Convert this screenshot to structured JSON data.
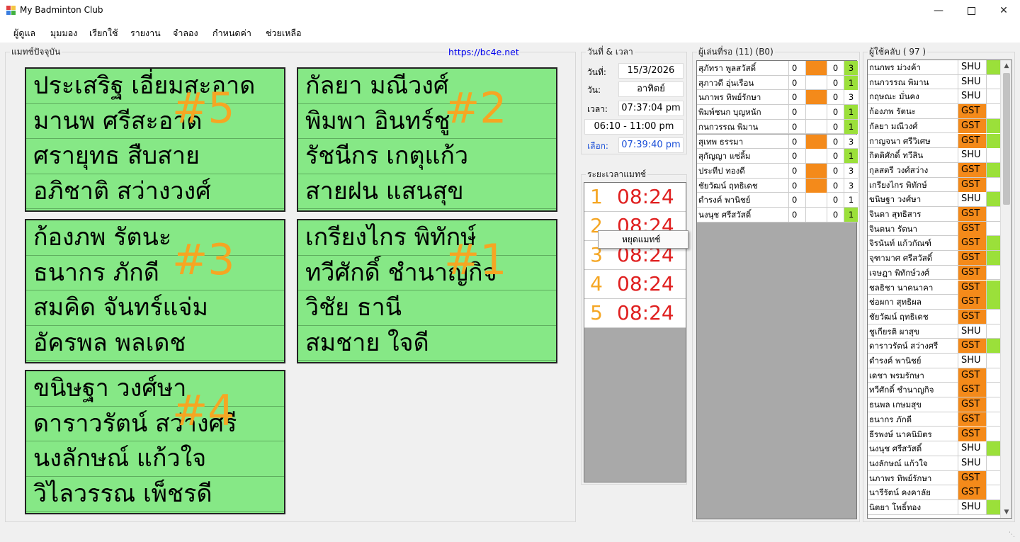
{
  "window": {
    "title": "My Badminton Club",
    "minimize_icon": "minimize-icon",
    "maximize_icon": "maximize-icon",
    "close_icon": "close-icon"
  },
  "menu": {
    "items": [
      "ผู้ดูแล",
      "มุมมอง",
      "เรียกใช้",
      "รายงาน",
      "จำลอง",
      "กำหนดค่า",
      "ช่วยเหลือ"
    ]
  },
  "current_matches": {
    "label": "แมทช์ปัจจุบัน",
    "link": "https://bc4e.net",
    "matches": [
      {
        "number": "#5",
        "players": [
          "ประเสริฐ เอี่ยมสะอาด",
          "มานพ ศรีสะอาด",
          "ศรายุทธ สืบสาย",
          "อภิชาติ สว่างวงศ์"
        ]
      },
      {
        "number": "#2",
        "players": [
          "กัลยา มณีวงศ์",
          "พิมพา อินทร์ชู",
          "รัชนีกร เกตุแก้ว",
          "สายฝน แสนสุข"
        ]
      },
      {
        "number": "#3",
        "players": [
          "ก้องภพ รัตนะ",
          "ธนากร ภักดี",
          "สมคิด จันทร์แจ่ม",
          "อัครพล พลเดช"
        ]
      },
      {
        "number": "#1",
        "players": [
          "เกรียงไกร พิทักษ์",
          "ทวีศักดิ์ ชำนาญกิจ",
          "วิชัย ธานี",
          "สมชาย ใจดี"
        ]
      },
      {
        "number": "#4",
        "players": [
          "ขนิษฐา วงศ์ษา",
          "ดาราวรัตน์ สว่างศรี",
          "นงลักษณ์ แก้วใจ",
          "วิไลวรรณ เพ็ชรดี"
        ]
      }
    ]
  },
  "datetime": {
    "label": "วันที่ & เวลา",
    "date_label": "วันที่:",
    "date": "15/3/2026",
    "day_label": "วัน:",
    "day": "อาทิตย์",
    "time_label": "เวลา:",
    "time": "07:37:04 pm",
    "session": "06:10 - 11:00 pm",
    "select_label": "เลือก:",
    "select_time": "07:39:40 pm"
  },
  "match_timers": {
    "label": "ระยะเวลาแมทช์",
    "timers": [
      {
        "idx": "1",
        "time": "08:24"
      },
      {
        "idx": "2",
        "time": "08:24"
      },
      {
        "idx": "3",
        "time": "08:24"
      },
      {
        "idx": "4",
        "time": "08:24"
      },
      {
        "idx": "5",
        "time": "08:24"
      }
    ],
    "context_menu": "หยุดแมทช์"
  },
  "waiting": {
    "label": "ผู้เล่นที่รอ (11) (B0)",
    "rows": [
      {
        "name": "สุภัทรา พูลสวัสดิ์",
        "a": "0",
        "b": "0",
        "c": "3",
        "orange": true,
        "green": true
      },
      {
        "name": "สุภาวดี อุ่นเรือน",
        "a": "0",
        "b": "0",
        "c": "1",
        "orange": false,
        "green": true
      },
      {
        "name": "นภาพร ทิพย์รักษา",
        "a": "0",
        "b": "0",
        "c": "3",
        "orange": true,
        "green": false
      },
      {
        "name": "พิมพ์ชนก บุญหนัก",
        "a": "0",
        "b": "0",
        "c": "1",
        "orange": false,
        "green": true
      },
      {
        "name": "กนกวรรณ พิมาน",
        "a": "0",
        "b": "0",
        "c": "1",
        "orange": false,
        "green": true
      },
      {
        "name": "สุเทพ ธรรมา",
        "a": "0",
        "b": "0",
        "c": "3",
        "orange": true,
        "green": false
      },
      {
        "name": "สุกัญญา แซ่ลิ้ม",
        "a": "0",
        "b": "0",
        "c": "1",
        "orange": false,
        "green": true
      },
      {
        "name": "ประทีป ทองดี",
        "a": "0",
        "b": "0",
        "c": "3",
        "orange": true,
        "green": false
      },
      {
        "name": "ชัยวัฒน์ ฤทธิเดช",
        "a": "0",
        "b": "0",
        "c": "3",
        "orange": true,
        "green": false
      },
      {
        "name": "ดำรงค์ พานิชย์",
        "a": "0",
        "b": "0",
        "c": "1",
        "orange": false,
        "green": false
      },
      {
        "name": "นงนุช ศรีสวัสดิ์",
        "a": "0",
        "b": "0",
        "c": "1",
        "orange": false,
        "green": true
      }
    ]
  },
  "members": {
    "label": "ผู้ใช้คลับ ( 97 )",
    "rows": [
      {
        "name": "กนกพร ม่วงค้า",
        "type": "SHU",
        "green": true
      },
      {
        "name": "กนกวรรณ พิมาน",
        "type": "SHU",
        "green": false
      },
      {
        "name": "กฤษณะ มั่นคง",
        "type": "SHU",
        "green": false
      },
      {
        "name": "ก้องภพ รัตนะ",
        "type": "GST",
        "green": false
      },
      {
        "name": "กัลยา มณีวงศ์",
        "type": "GST",
        "green": true
      },
      {
        "name": "กาญจนา ศรีวิเศษ",
        "type": "GST",
        "green": true
      },
      {
        "name": "กิตติศักดิ์ ทวีสิน",
        "type": "SHU",
        "green": false
      },
      {
        "name": "กุลสตรี วงศ์สว่าง",
        "type": "GST",
        "green": true
      },
      {
        "name": "เกรียงไกร พิทักษ์",
        "type": "GST",
        "green": false
      },
      {
        "name": "ขนิษฐา วงศ์ษา",
        "type": "SHU",
        "green": true
      },
      {
        "name": "จินดา สุทธิสาร",
        "type": "GST",
        "green": false
      },
      {
        "name": "จินตนา รัตนา",
        "type": "GST",
        "green": false
      },
      {
        "name": "จิรนันท์ แก้วกัณฑ์",
        "type": "GST",
        "green": true
      },
      {
        "name": "จุฑามาศ ศรีสวัสดิ์",
        "type": "GST",
        "green": true
      },
      {
        "name": "เจษฎา พิทักษ์วงศ์",
        "type": "GST",
        "green": false
      },
      {
        "name": "ชลธิชา นาคนาคา",
        "type": "GST",
        "green": true
      },
      {
        "name": "ช่อผกา สุทธิผล",
        "type": "GST",
        "green": true
      },
      {
        "name": "ชัยวัฒน์ ฤทธิเดช",
        "type": "GST",
        "green": false
      },
      {
        "name": "ชูเกียรติ ผาสุข",
        "type": "SHU",
        "green": false
      },
      {
        "name": "ดาราวรัตน์ สว่างศรี",
        "type": "GST",
        "green": true
      },
      {
        "name": "ดำรงค์ พานิชย์",
        "type": "SHU",
        "green": false
      },
      {
        "name": "เดชา พรมรักษา",
        "type": "GST",
        "green": false
      },
      {
        "name": "ทวีศักดิ์ ชำนาญกิจ",
        "type": "GST",
        "green": false
      },
      {
        "name": "ธนพล เกษมสุข",
        "type": "GST",
        "green": false
      },
      {
        "name": "ธนากร ภักดี",
        "type": "GST",
        "green": false
      },
      {
        "name": "ธีรพงษ์ นาคนิมิตร",
        "type": "GST",
        "green": false
      },
      {
        "name": "นงนุช ศรีสวัสดิ์",
        "type": "SHU",
        "green": true
      },
      {
        "name": "นงลักษณ์ แก้วใจ",
        "type": "SHU",
        "green": false
      },
      {
        "name": "นภาพร ทิพย์รักษา",
        "type": "GST",
        "green": false
      },
      {
        "name": "นารีรัตน์ คงคาลัย",
        "type": "GST",
        "green": false
      },
      {
        "name": "นิตยา โพธิ์ทอง",
        "type": "SHU",
        "green": true
      }
    ]
  },
  "colors": {
    "match_bg": "#86e886",
    "orange": "#f48a1a",
    "green_flag": "#9be03a",
    "timer_red": "#e02020",
    "match_number": "#f5a623",
    "link": "#0000ee"
  }
}
